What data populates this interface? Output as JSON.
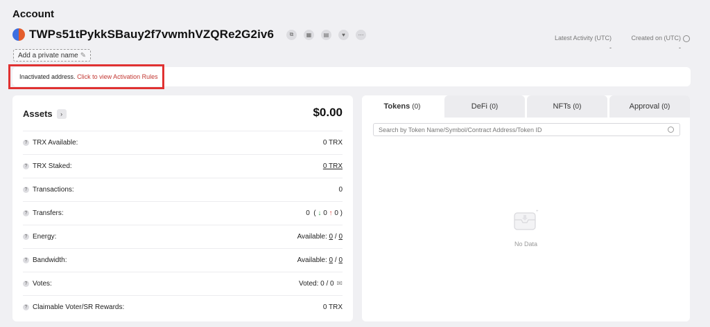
{
  "header": {
    "title": "Account"
  },
  "account": {
    "address": "TWPs51tPykkSBauy2f7vwmhVZQRe2G2iv6",
    "private_name_label": "Add a private name"
  },
  "meta": {
    "latest_activity_label": "Latest Activity (UTC)",
    "latest_activity_value": "-",
    "created_on_label": "Created on (UTC)",
    "created_on_value": "-"
  },
  "banner": {
    "text": "Inactivated address.",
    "link": "Click to view Activation Rules"
  },
  "assets": {
    "title": "Assets",
    "total": "$0.00",
    "rows": [
      {
        "label": "TRX Available:",
        "value": "0 TRX"
      },
      {
        "label": "TRX Staked:",
        "value": "0 TRX"
      },
      {
        "label": "Transactions:",
        "value": "0"
      },
      {
        "label": "Transfers:",
        "total": "0",
        "in": "0",
        "out": "0"
      },
      {
        "label": "Energy:",
        "prefix": "Available:",
        "a": "0",
        "b": "0"
      },
      {
        "label": "Bandwidth:",
        "prefix": "Available:",
        "a": "0",
        "b": "0"
      },
      {
        "label": "Votes:",
        "value": "Voted: 0 / 0"
      },
      {
        "label": "Claimable Voter/SR Rewards:",
        "value": "0 TRX"
      }
    ]
  },
  "tabs": [
    {
      "label": "Tokens",
      "count": "(0)"
    },
    {
      "label": "DeFi",
      "count": "(0)"
    },
    {
      "label": "NFTs",
      "count": "(0)"
    },
    {
      "label": "Approval",
      "count": "(0)"
    }
  ],
  "tokens": {
    "search_placeholder": "Search by Token Name/Symbol/Contract Address/Token ID",
    "empty_text": "No Data"
  },
  "colors": {
    "highlight": "#e03131",
    "link": "#c23631",
    "arrow_up": "#e0413a",
    "arrow_down": "#2fa24d"
  }
}
